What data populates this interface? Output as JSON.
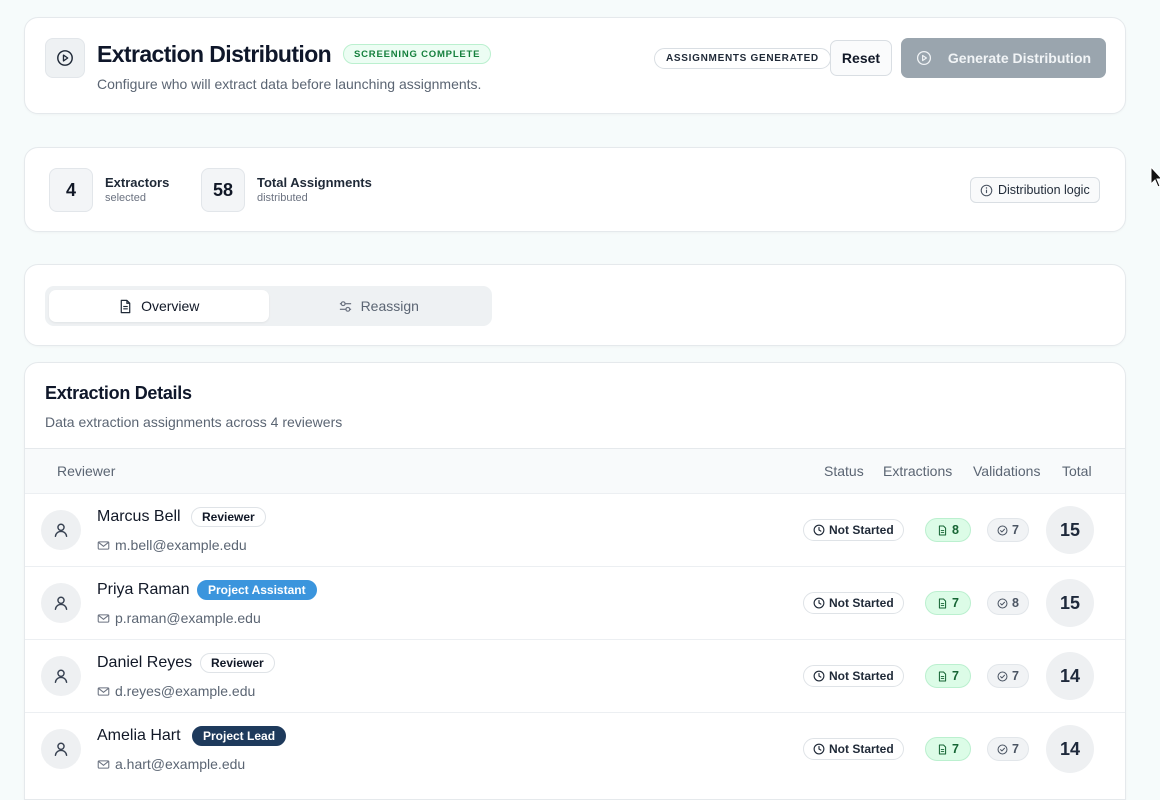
{
  "header": {
    "title": "Extraction Distribution",
    "badge": "SCREENING COMPLETE",
    "subtitle": "Configure who will extract data before launching assignments.",
    "status_pill": "ASSIGNMENTS GENERATED",
    "reset_label": "Reset",
    "generate_label": "Generate Distribution"
  },
  "stats": {
    "extractors": {
      "value": "4",
      "label": "Extractors",
      "sub": "selected"
    },
    "assignments": {
      "value": "58",
      "label": "Total Assignments",
      "sub": "distributed"
    },
    "logic_label": "Distribution logic"
  },
  "tabs": [
    {
      "label": "Overview",
      "icon": "document-icon",
      "active": true
    },
    {
      "label": "Reassign",
      "icon": "sliders-icon",
      "active": false
    }
  ],
  "details": {
    "title": "Extraction Details",
    "subtitle": "Data extraction assignments across 4 reviewers",
    "columns": {
      "reviewer": "Reviewer",
      "status": "Status",
      "extractions": "Extractions",
      "validations": "Validations",
      "total": "Total"
    },
    "rows": [
      {
        "name": "Marcus Bell",
        "role": "Reviewer",
        "role_style": "reviewer",
        "email": "m.bell@example.edu",
        "status": "Not Started",
        "extractions": "8",
        "validations": "7",
        "total": "15"
      },
      {
        "name": "Priya Raman",
        "role": "Project Assistant",
        "role_style": "assistant",
        "email": "p.raman@example.edu",
        "status": "Not Started",
        "extractions": "7",
        "validations": "8",
        "total": "15"
      },
      {
        "name": "Daniel Reyes",
        "role": "Reviewer",
        "role_style": "reviewer",
        "email": "d.reyes@example.edu",
        "status": "Not Started",
        "extractions": "7",
        "validations": "7",
        "total": "14"
      },
      {
        "name": "Amelia Hart",
        "role": "Project Lead",
        "role_style": "lead",
        "email": "a.hart@example.edu",
        "status": "Not Started",
        "extractions": "7",
        "validations": "7",
        "total": "14"
      }
    ]
  },
  "colors": {
    "page_bg": "#f6fbfb",
    "success_green": "#15803d",
    "assistant_blue": "#3b95dd",
    "lead_navy": "#1e3a5c",
    "disabled_button": "#9aa5ae"
  }
}
